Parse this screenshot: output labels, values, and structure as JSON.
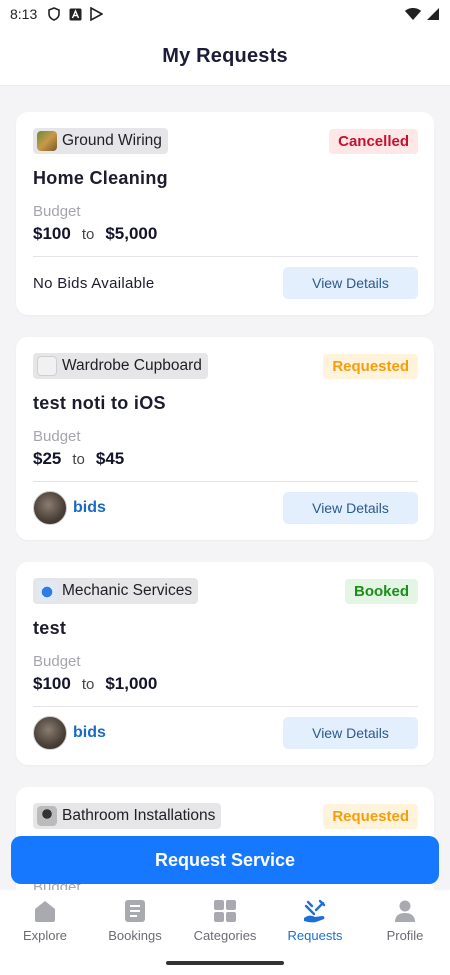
{
  "status_bar": {
    "time": "8:13"
  },
  "header": {
    "title": "My Requests"
  },
  "requests": [
    {
      "category": "Ground Wiring",
      "status": "Cancelled",
      "title": "Home Cleaning",
      "budget_label": "Budget",
      "budget_min": "$100",
      "budget_to": "to",
      "budget_max": "$5,000",
      "bids_text": "No Bids Available",
      "action": "View Details"
    },
    {
      "category": "Wardrobe Cupboard",
      "status": "Requested",
      "title": "test noti to iOS",
      "budget_label": "Budget",
      "budget_min": "$25",
      "budget_to": "to",
      "budget_max": "$45",
      "bids_text": "bids",
      "action": "View Details"
    },
    {
      "category": "Mechanic Services",
      "status": "Booked",
      "title": "test",
      "budget_label": "Budget",
      "budget_min": "$100",
      "budget_to": "to",
      "budget_max": "$1,000",
      "bids_text": "bids",
      "action": "View Details"
    },
    {
      "category": "Bathroom Installations",
      "status": "Requested",
      "budget_label": "Budget"
    }
  ],
  "cta": {
    "label": "Request Service"
  },
  "nav": {
    "items": [
      {
        "label": "Explore",
        "icon": "home-icon"
      },
      {
        "label": "Bookings",
        "icon": "document-icon"
      },
      {
        "label": "Categories",
        "icon": "grid-icon"
      },
      {
        "label": "Requests",
        "icon": "requests-icon",
        "active": true
      },
      {
        "label": "Profile",
        "icon": "person-icon"
      }
    ]
  },
  "colors": {
    "primary": "#1677ff",
    "cancelled": "#c8102e",
    "requested": "#f59e0b",
    "booked": "#1a8f1a"
  }
}
